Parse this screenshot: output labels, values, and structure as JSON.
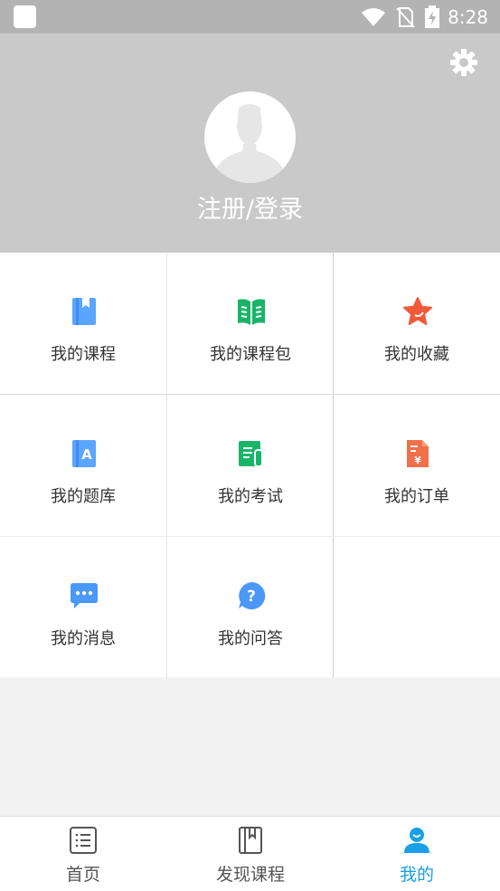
{
  "status_bar": {
    "time": "8:28"
  },
  "header": {
    "login_label": "注册/登录"
  },
  "menu": {
    "items": [
      {
        "label": "我的课程"
      },
      {
        "label": "我的课程包"
      },
      {
        "label": "我的收藏"
      },
      {
        "label": "我的题库"
      },
      {
        "label": "我的考试"
      },
      {
        "label": "我的订单"
      },
      {
        "label": "我的消息"
      },
      {
        "label": "我的问答"
      }
    ]
  },
  "tabbar": {
    "tabs": [
      {
        "label": "首页"
      },
      {
        "label": "发现课程"
      },
      {
        "label": "我的",
        "active": true
      }
    ]
  },
  "colors": {
    "accent": "#1aa0e8",
    "header_bg": "#c9c9c9",
    "statusbar_bg": "#b3b3b3"
  }
}
